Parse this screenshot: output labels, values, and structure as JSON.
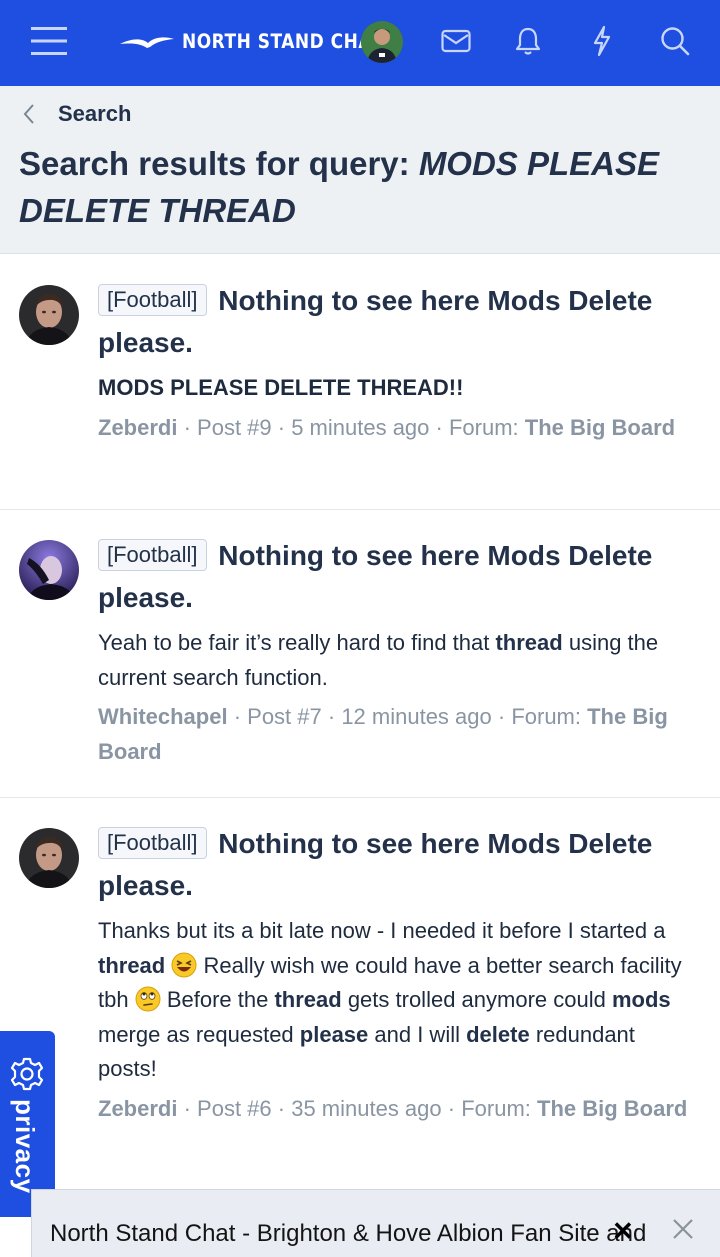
{
  "header": {
    "logo_text": "NORTH STAND CHAT",
    "icons": [
      "menu-icon",
      "logo-seagull-icon",
      "avatar",
      "envelope-icon",
      "bell-icon",
      "lightning-icon",
      "search-icon"
    ]
  },
  "breadcrumb": {
    "label": "Search"
  },
  "page_title": {
    "prefix": "Search results for query: ",
    "query": "MODS PLEASE DELETE THREAD"
  },
  "results": [
    {
      "prefix": "[Football]",
      "title": "Nothing to see here Mods Delete please.",
      "snippet": "MODS PLEASE DELETE THREAD!!",
      "author": "Zeberdi",
      "sep1": " · ",
      "post": "Post #9",
      "sep2": " · ",
      "time": "5 minutes ago",
      "sep3": " · ",
      "forum_label": "Forum: ",
      "forum": "The Big Board"
    },
    {
      "prefix": "[Football]",
      "title": "Nothing to see here Mods Delete please.",
      "snippet_parts": [
        "Yeah to be fair it’s really hard to find that ",
        "thread",
        " using the current search function."
      ],
      "author": "Whitechapel",
      "sep1": " · ",
      "post": "Post #7",
      "sep2": " · ",
      "time": "12 minutes ago",
      "sep3": " · ",
      "forum_label": "Forum: ",
      "forum": "The Big Board"
    },
    {
      "prefix": "[Football]",
      "title": "Nothing to see here Mods Delete please.",
      "snippet_parts": [
        "Thanks but its a bit late now - I needed it before I started a ",
        "thread",
        " Really wish we could have a better search facility tbh ",
        " Before the ",
        "thread",
        " gets trolled anymore could ",
        "mods",
        " merge as requested ",
        "please",
        " and I will ",
        "delete",
        " redundant posts!"
      ],
      "author": "Zeberdi",
      "sep1": " · ",
      "post": "Post #6",
      "sep2": " · ",
      "time": "35 minutes ago",
      "sep3": " · ",
      "forum_label": "Forum: ",
      "forum": "The Big Board"
    }
  ],
  "privacy": {
    "label": "privacy",
    "icon": "gear-icon"
  },
  "bottom_bar": {
    "title": "North Stand Chat - Brighton & Hove Albion Fan Site and"
  },
  "colors": {
    "header_bg": "#1f4fe0",
    "title_bg": "#eef1f4",
    "title_text": "#23324a",
    "meta_text": "#8a95a3"
  }
}
